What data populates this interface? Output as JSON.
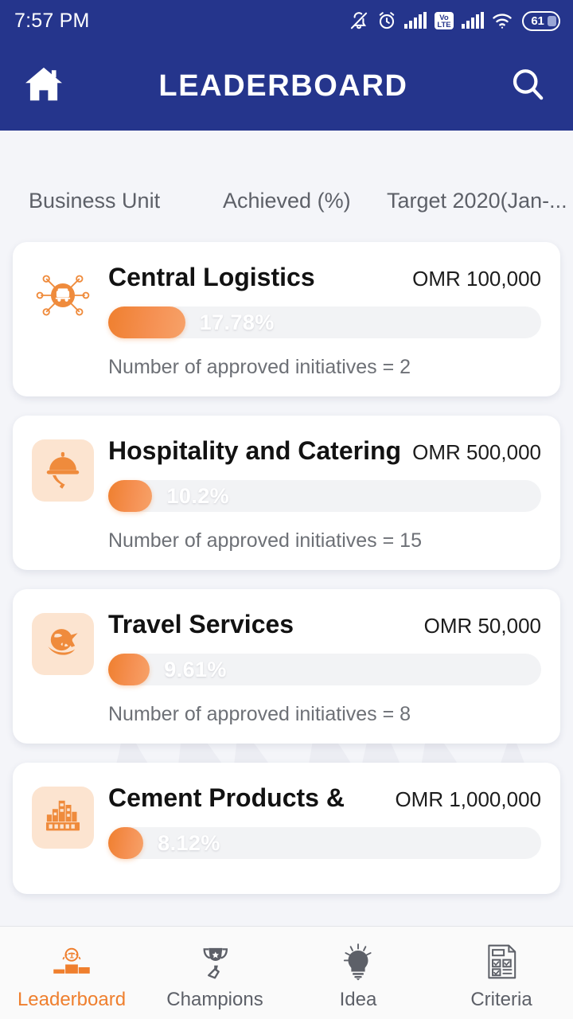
{
  "status_bar": {
    "time": "7:57 PM",
    "battery_level": "61",
    "icons": [
      "bell-off-icon",
      "alarm-clock-icon",
      "signal-bars-icon",
      "volte-icon",
      "signal-bars-icon",
      "wifi-icon",
      "battery-icon"
    ],
    "volte_top": "Vo",
    "volte_bottom": "LTE"
  },
  "app_bar": {
    "title": "LEADERBOARD",
    "home_icon": "home-icon",
    "search_icon": "search-icon"
  },
  "colors": {
    "header_blue": "#25358C",
    "accent_orange": "#EF7F2E",
    "page_background": "#F4F5F9",
    "card_white": "#FFFFFF",
    "icon_tile": "#FCE4D0",
    "track_grey": "#F2F3F5"
  },
  "column_headers": [
    "Business Unit",
    "Achieved (%)",
    "Target 2020(Jan-..."
  ],
  "cards": [
    {
      "title": "Central Logistics",
      "target": "OMR 100,000",
      "percent_label": "17.78%",
      "percent_value": 17.78,
      "note": "Number of approved initiatives = 2",
      "icon": "logistics-network-icon",
      "icon_tile": false
    },
    {
      "title": "Hospitality and Catering",
      "target": "OMR 500,000",
      "percent_label": "10.2%",
      "percent_value": 10.2,
      "note": "Number of approved initiatives = 15",
      "icon": "food-cloche-icon",
      "icon_tile": true
    },
    {
      "title": "Travel Services",
      "target": "OMR 50,000",
      "percent_label": "9.61%",
      "percent_value": 9.61,
      "note": "Number of approved initiatives = 8",
      "icon": "globe-airplane-icon",
      "icon_tile": true
    },
    {
      "title": "Cement Products &",
      "target": "OMR 1,000,000",
      "percent_label": "8.12%",
      "percent_value": 8.12,
      "note": "",
      "icon": "cement-buildings-icon",
      "icon_tile": true
    }
  ],
  "bottom_nav": {
    "active": "Leaderboard",
    "items": [
      {
        "label": "Leaderboard",
        "icon": "podium-icon"
      },
      {
        "label": "Champions",
        "icon": "trophy-icon"
      },
      {
        "label": "Idea",
        "icon": "lightbulb-head-icon"
      },
      {
        "label": "Criteria",
        "icon": "checklist-document-icon"
      }
    ]
  }
}
